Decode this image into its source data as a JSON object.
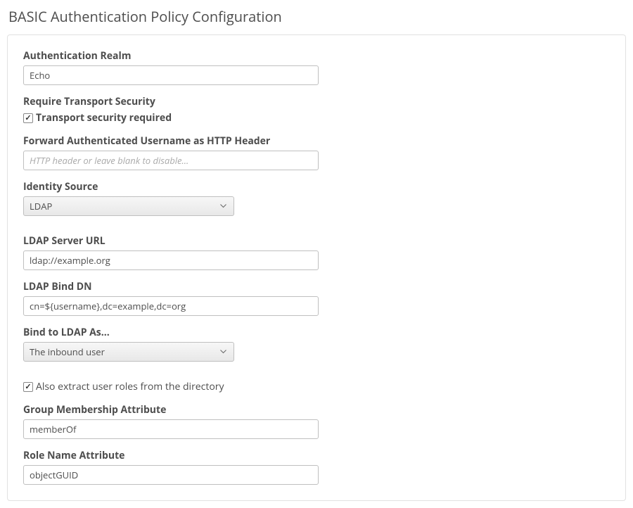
{
  "page_title": "BASIC Authentication Policy Configuration",
  "fields": {
    "auth_realm": {
      "label": "Authentication Realm",
      "value": "Echo"
    },
    "require_transport": {
      "label": "Require Transport Security",
      "checkbox_label": "Transport security required",
      "checked": true
    },
    "forward_header": {
      "label": "Forward Authenticated Username as HTTP Header",
      "value": "",
      "placeholder": "HTTP header or leave blank to disable..."
    },
    "identity_source": {
      "label": "Identity Source",
      "value": "LDAP"
    },
    "ldap_url": {
      "label": "LDAP Server URL",
      "value": "ldap://example.org"
    },
    "ldap_bind_dn": {
      "label": "LDAP Bind DN",
      "value": "cn=${username},dc=example,dc=org"
    },
    "bind_as": {
      "label": "Bind to LDAP As...",
      "value": "The inbound user"
    },
    "extract_roles": {
      "checkbox_label": "Also extract user roles from the directory",
      "checked": true
    },
    "group_attr": {
      "label": "Group Membership Attribute",
      "value": "memberOf"
    },
    "role_attr": {
      "label": "Role Name Attribute",
      "value": "objectGUID"
    }
  }
}
